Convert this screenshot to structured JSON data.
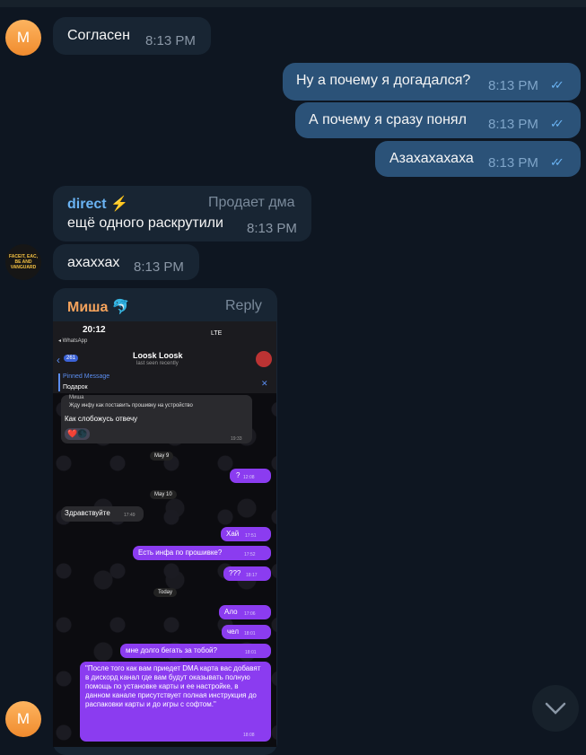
{
  "messages": {
    "m1": {
      "avatar": "M",
      "text": "Согласен",
      "time": "8:13 PM"
    },
    "m2": {
      "text": "Ну а почему я догадался?",
      "time": "8:13 PM"
    },
    "m3": {
      "text": "А почему я сразу понял",
      "time": "8:13 PM"
    },
    "m4": {
      "text": "Азахахахаха",
      "time": "8:13 PM"
    },
    "m5": {
      "sender": "direct ⚡",
      "side": "Продает дма",
      "text": "ещё одного раскрутили",
      "time": "8:13 PM"
    },
    "m6": {
      "avatar": "FACEIT, EAC, BE AND VANGUARD",
      "text": "ахаххах",
      "time": "8:13 PM"
    },
    "m7": {
      "sender": "Миша 🐬",
      "action": "Reply"
    },
    "last_avatar": "M"
  },
  "screenshot": {
    "clock": "20:12",
    "back_app": "◂ WhatsApp",
    "signal": "LTE",
    "back_count": "261",
    "contact_name": "Loosk Loosk",
    "contact_status": "last seen recently",
    "pinned_label": "Pinned Message",
    "pinned_text": "Подарок",
    "quote_name": "Миша",
    "quote_text": "Жду инфу как поставить прошивку на устройство",
    "reply_text": "Как слобожусь отвечу",
    "reply_time": "19:33",
    "date1": "May 9",
    "q": "?",
    "q_time": "12:08",
    "date2": "May 10",
    "hello": "Здравствуйте",
    "hello_time": "17:49",
    "hai": "Хай",
    "hai_time": "17:51",
    "info": "Есть инфа по прошивке?",
    "info_time": "17:52",
    "qqq": "???",
    "qqq_time": "18:17",
    "date3": "Today",
    "alo": "Ало",
    "alo_time": "17:06",
    "chel": "чел",
    "chel_time": "18:01",
    "long": "мне долго бегать за тобой?",
    "long_time": "18:01",
    "quote_big": "\"После того как вам приедет DMA карта вас добавят в дискорд канал где вам будут оказывать полную помощь по установке карты и ее настройке, в данном канале присутствует полная инструкция до распаковки карты и до игры с софтом.\"",
    "quote_big_time": "18:08"
  }
}
